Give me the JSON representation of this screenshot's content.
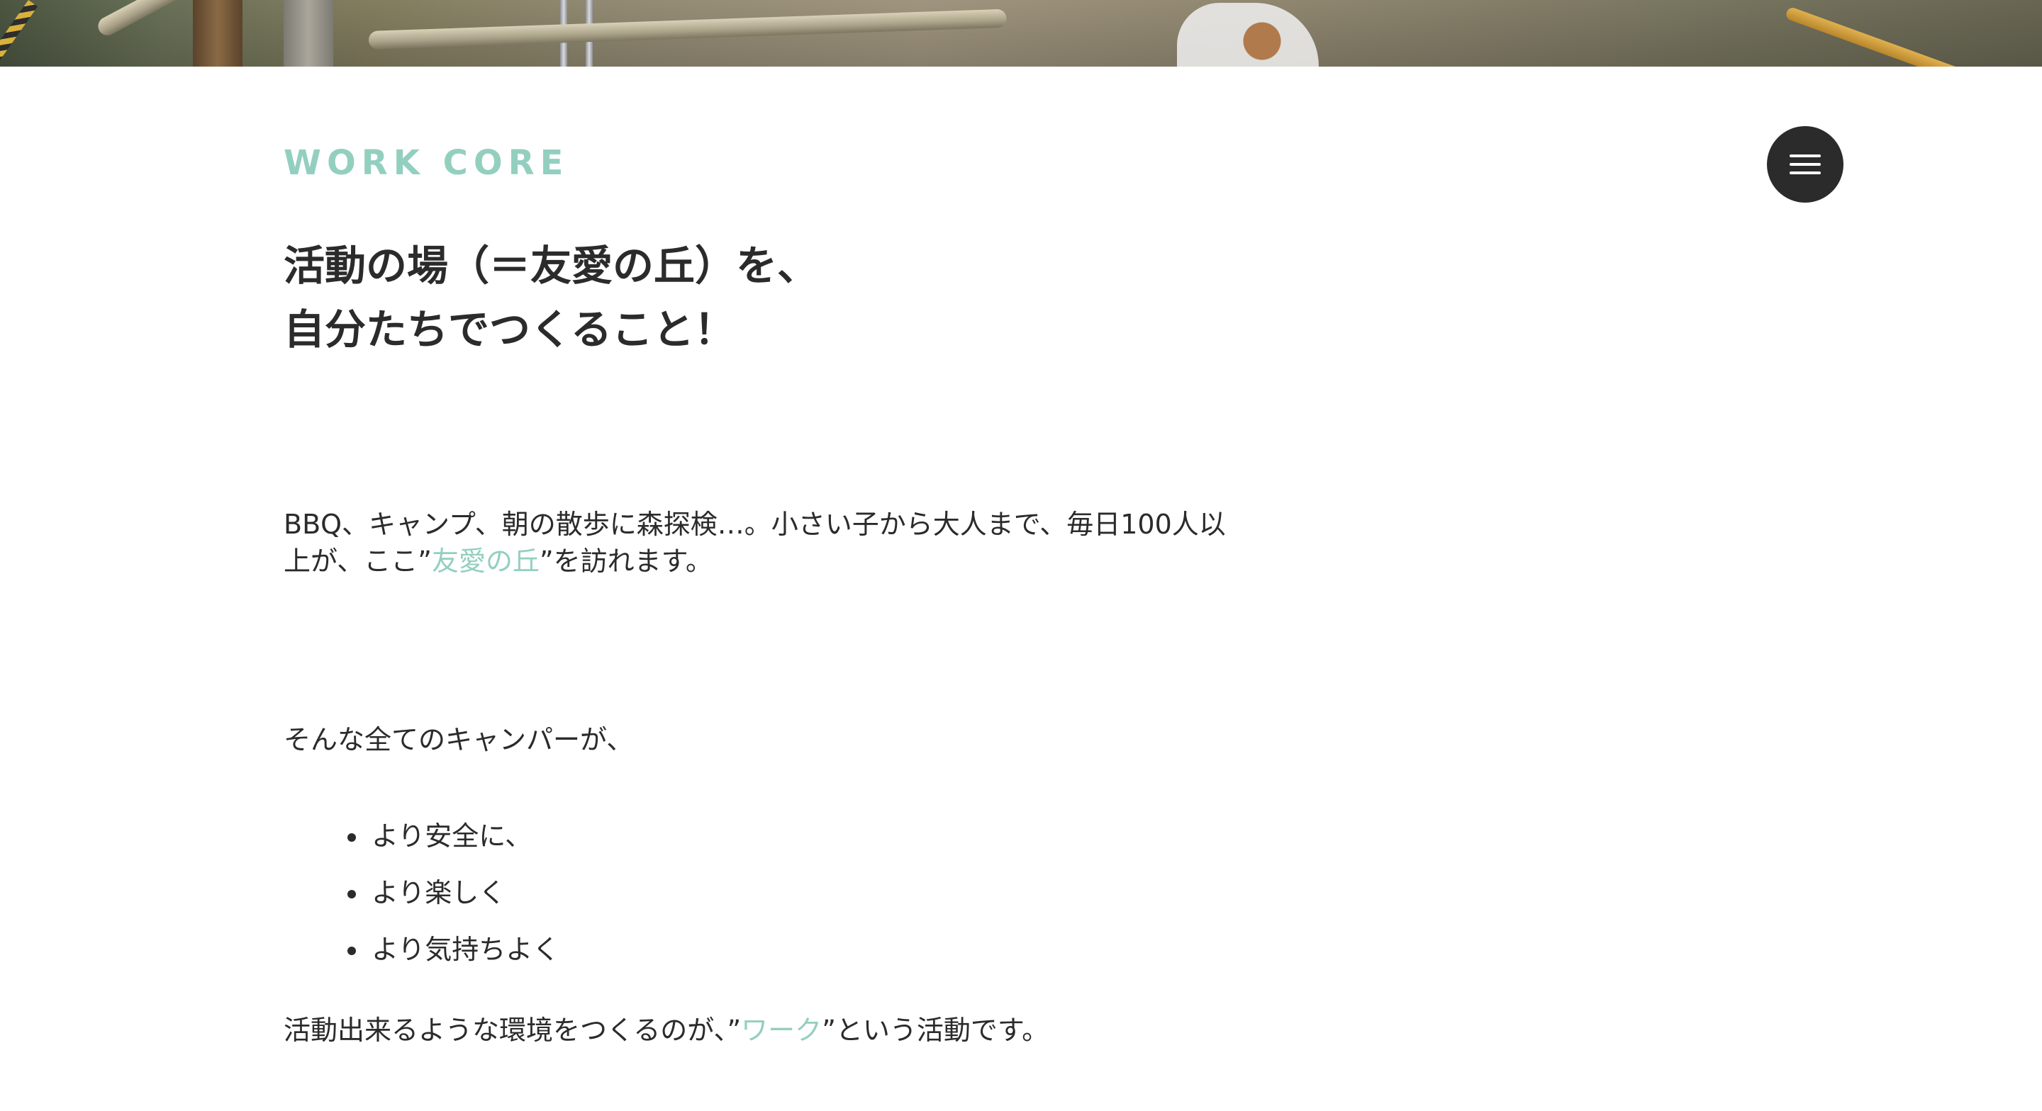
{
  "header": {
    "site_title": "WORK CORE",
    "menu_icon": "hamburger-menu-icon"
  },
  "main": {
    "headline_line1": "活動の場（＝友愛の丘）を、",
    "headline_line2": "自分たちでつくること！",
    "para1_before": "BBQ、キャンプ、朝の散歩に森探検…。小さい子から大人まで、毎日100人以上が、ここ”",
    "para1_link": "友愛の丘",
    "para1_after": "”を訪れます。",
    "para2": "そんな全てのキャンパーが、",
    "bullets": [
      "より安全に、",
      "より楽しく",
      "より気持ちよく"
    ],
    "para3_before": "活動出来るような環境をつくるのが、”",
    "para3_link": "ワーク",
    "para3_after": "”という活動です。"
  },
  "colors": {
    "accent": "#93cfbf",
    "text": "#2b2b2b",
    "menu_button_bg": "#2b2b2b",
    "background": "#ffffff"
  }
}
